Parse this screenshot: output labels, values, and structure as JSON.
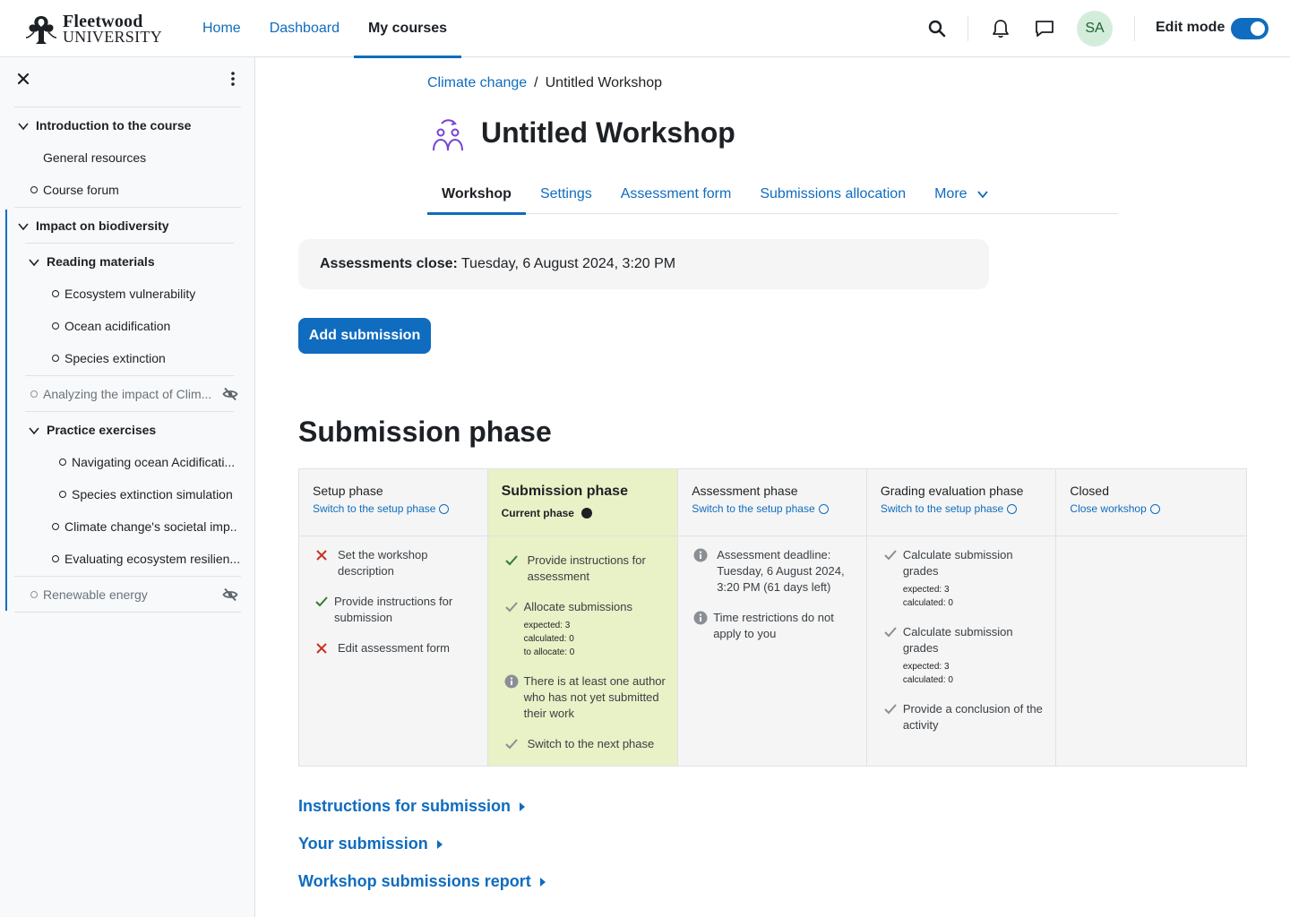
{
  "brand": {
    "name_line1": "Fleetwood",
    "name_line2": "UNIVERSITY"
  },
  "primary_nav": [
    "Home",
    "Dashboard",
    "My courses"
  ],
  "user": {
    "initials": "SA"
  },
  "edit_mode_label": "Edit mode",
  "sidebar": {
    "items": [
      {
        "label": "Introduction to the course"
      },
      {
        "label": "General resources"
      },
      {
        "label": "Course forum"
      },
      {
        "label": "Impact on biodiversity"
      },
      {
        "label": "Reading materials"
      },
      {
        "label": "Ecosystem vulnerability"
      },
      {
        "label": "Ocean acidification"
      },
      {
        "label": "Species extinction"
      },
      {
        "label": "Analyzing the impact of Clim..."
      },
      {
        "label": "Practice exercises"
      },
      {
        "label": "Navigating ocean Acidificati..."
      },
      {
        "label": "Species extinction simulation"
      },
      {
        "label": "Climate change's societal imp.."
      },
      {
        "label": "Evaluating ecosystem resilien..."
      },
      {
        "label": "Renewable energy"
      }
    ]
  },
  "breadcrumb": {
    "parent": "Climate change",
    "current": "Untitled Workshop"
  },
  "page_title": "Untitled Workshop",
  "tabs": [
    "Workshop",
    "Settings",
    "Assessment form",
    "Submissions allocation",
    "More"
  ],
  "alert": {
    "label": "Assessments close:",
    "value": "Tuesday, 6 August 2024, 3:20 PM"
  },
  "add_submission": "Add submission",
  "phase_heading": "Submission phase",
  "phases": [
    {
      "title": "Setup phase",
      "link": "Switch to the setup phase",
      "tasks": [
        {
          "text": "Set the workshop description"
        },
        {
          "text": "Provide instructions for submission"
        },
        {
          "text": "Edit assessment form"
        }
      ]
    },
    {
      "title": "Submission phase",
      "current": "Current phase",
      "tasks": [
        {
          "text": "Provide instructions for assessment"
        },
        {
          "text": "Allocate submissions",
          "details": [
            "expected: 3",
            "calculated: 0",
            "to allocate: 0"
          ]
        },
        {
          "text": "There is at least one author who has not yet submitted their work"
        },
        {
          "text": "Switch to the next phase"
        }
      ]
    },
    {
      "title": "Assessment phase",
      "link": "Switch to the setup phase",
      "tasks": [
        {
          "text": "Assessment deadline: Tuesday, 6 August 2024, 3:20 PM (61 days left)"
        },
        {
          "text": "Time restrictions do not apply to you"
        }
      ]
    },
    {
      "title": "Grading evaluation phase",
      "link": "Switch to the setup phase",
      "tasks": [
        {
          "text": "Calculate submission grades",
          "details": [
            "expected: 3",
            "calculated: 0"
          ]
        },
        {
          "text": "Calculate submission grades",
          "details": [
            "expected: 3",
            "calculated: 0"
          ]
        },
        {
          "text": "Provide a conclusion of the activity"
        }
      ]
    },
    {
      "title": "Closed",
      "link": "Close workshop",
      "tasks": []
    }
  ],
  "sections": [
    "Instructions for submission",
    "Your submission",
    "Workshop submissions report"
  ],
  "colors": {
    "accent": "#0f6cbf",
    "current_phase_bg": "#e9f1c6",
    "fail": "#ca3120",
    "pass": "#357a32"
  }
}
